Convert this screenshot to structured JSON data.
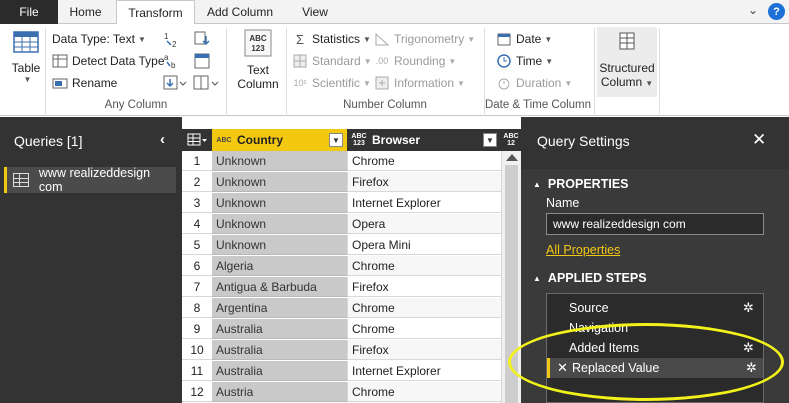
{
  "tabs": {
    "file": "File",
    "items": [
      {
        "label": "Home"
      },
      {
        "label": "Transform",
        "active": true
      },
      {
        "label": "Add Column"
      },
      {
        "label": "View"
      }
    ]
  },
  "window": {
    "help": "?",
    "chevron": "⌄"
  },
  "ribbon": {
    "table": {
      "label": "Table"
    },
    "any_column": {
      "group_label": "Any Column",
      "data_type": "Data Type: Text",
      "detect_type": "Detect Data Type",
      "rename": "Rename"
    },
    "text_column": {
      "label_line1": "Text",
      "label_line2": "Column",
      "icon_text": "ABC\n123"
    },
    "number_column": {
      "group_label": "Number Column",
      "statistics": "Statistics",
      "standard": "Standard",
      "scientific": "Scientific",
      "trigonometry": "Trigonometry",
      "rounding": "Rounding",
      "information": "Information"
    },
    "datetime_column": {
      "group_label": "Date & Time Column",
      "date": "Date",
      "time": "Time",
      "duration": "Duration"
    },
    "structured_column": {
      "label_line1": "Structured",
      "label_line2": "Column"
    }
  },
  "queries": {
    "title": "Queries [1]",
    "items": [
      {
        "label": "www realizeddesign com"
      }
    ]
  },
  "grid": {
    "columns": {
      "country": {
        "label": "Country",
        "type": "ABC"
      },
      "browser": {
        "label": "Browser",
        "type": "ABC 123"
      },
      "next": {
        "label": "ABC 12"
      }
    },
    "rows": [
      {
        "n": "1",
        "country": "Unknown",
        "browser": "Chrome"
      },
      {
        "n": "2",
        "country": "Unknown",
        "browser": "Firefox"
      },
      {
        "n": "3",
        "country": "Unknown",
        "browser": "Internet Explorer"
      },
      {
        "n": "4",
        "country": "Unknown",
        "browser": "Opera"
      },
      {
        "n": "5",
        "country": "Unknown",
        "browser": "Opera Mini"
      },
      {
        "n": "6",
        "country": "Algeria",
        "browser": "Chrome"
      },
      {
        "n": "7",
        "country": "Antigua & Barbuda",
        "browser": "Firefox"
      },
      {
        "n": "8",
        "country": "Argentina",
        "browser": "Chrome"
      },
      {
        "n": "9",
        "country": "Australia",
        "browser": "Chrome"
      },
      {
        "n": "10",
        "country": "Australia",
        "browser": "Firefox"
      },
      {
        "n": "11",
        "country": "Australia",
        "browser": "Internet Explorer"
      },
      {
        "n": "12",
        "country": "Austria",
        "browser": "Chrome"
      }
    ]
  },
  "settings": {
    "title": "Query Settings",
    "properties": {
      "title": "PROPERTIES",
      "name_label": "Name",
      "name_value": "www realizeddesign com",
      "all_properties": "All Properties"
    },
    "applied_steps": {
      "title": "APPLIED STEPS",
      "steps": [
        {
          "label": "Source",
          "has_gear": true
        },
        {
          "label": "Navigation",
          "has_gear": false
        },
        {
          "label": "Added Items",
          "has_gear": true
        },
        {
          "label": "Replaced Value",
          "has_gear": true,
          "selected": true
        }
      ]
    }
  },
  "colors": {
    "accent": "#f2c811",
    "dark_pane": "#333333",
    "highlight_ellipse": "#f2f21a"
  }
}
